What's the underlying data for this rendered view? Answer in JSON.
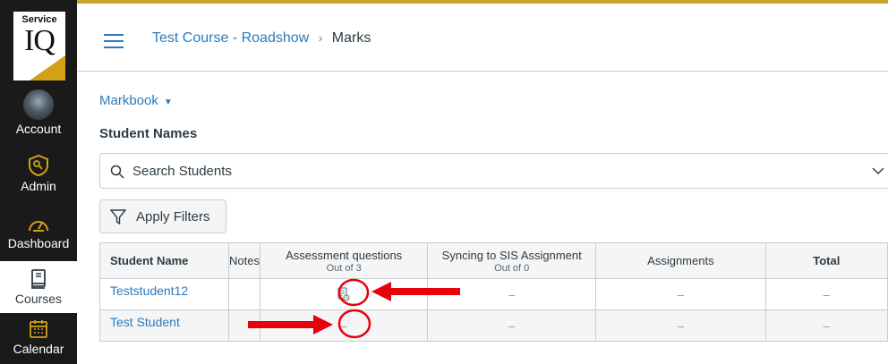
{
  "logo": {
    "service": "Service",
    "iq": "IQ"
  },
  "global_nav": {
    "account": "Account",
    "admin": "Admin",
    "dashboard": "Dashboard",
    "courses": "Courses",
    "calendar": "Calendar"
  },
  "header": {
    "course_link": "Test Course - Roadshow",
    "separator": "›",
    "current": "Marks"
  },
  "markbook": {
    "label": "Markbook",
    "caret": "▼"
  },
  "student_names_label": "Student Names",
  "search": {
    "placeholder": "Search Students"
  },
  "filters": {
    "label": "Apply Filters"
  },
  "table": {
    "columns": {
      "student_name": "Student Name",
      "notes": "Notes",
      "assessment": "Assessment questions",
      "assessment_sub": "Out of 3",
      "syncing": "Syncing to SIS Assignment",
      "syncing_sub": "Out of 0",
      "assignments": "Assignments",
      "total": "Total"
    },
    "rows": [
      {
        "name": "Teststudent12",
        "notes": "",
        "assessment": "",
        "syncing": "–",
        "assignments": "–",
        "total": "–"
      },
      {
        "name": "Test Student",
        "notes": "",
        "assessment": "–",
        "syncing": "–",
        "assignments": "–",
        "total": "–"
      }
    ]
  },
  "icons": {
    "menu": "hamburger-icon",
    "search": "search-icon",
    "chevron": "chevron-down-icon",
    "filter": "filter-icon",
    "needs_grading": "needs-grading-icon"
  },
  "colors": {
    "accent": "#c9a227",
    "link": "#2b7abc",
    "nav_bg": "#1a1a1a",
    "annotation": "#e8000b"
  }
}
